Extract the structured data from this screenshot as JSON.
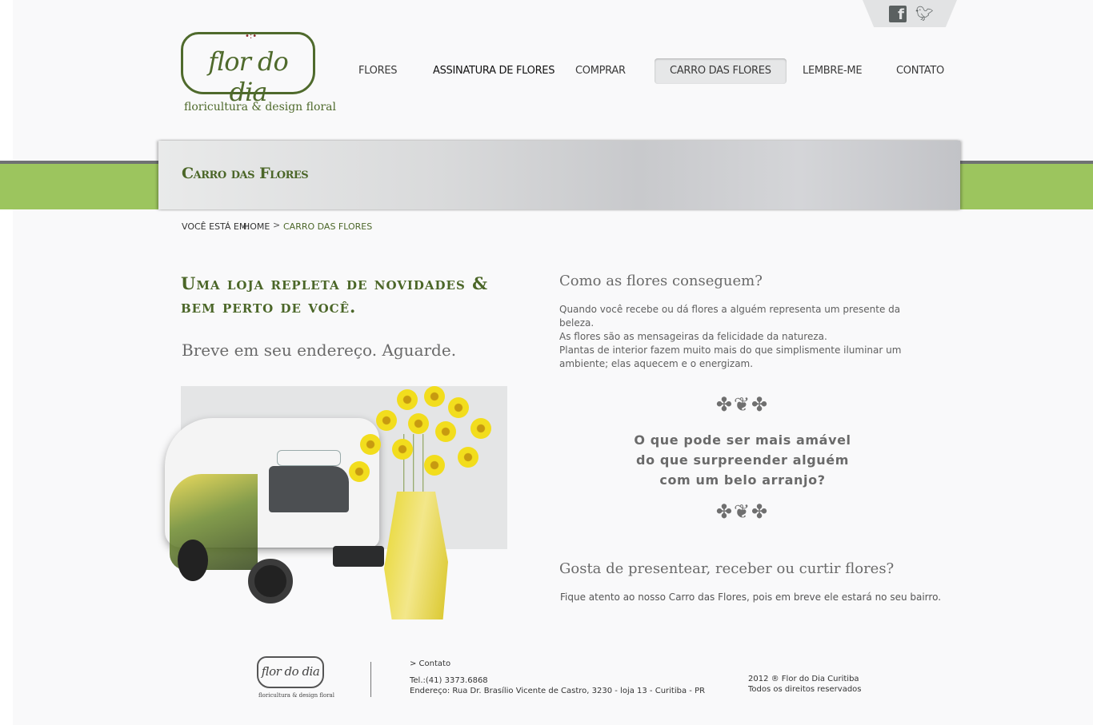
{
  "social": {
    "facebook_icon": "facebook-icon",
    "twitter_icon": "twitter-icon"
  },
  "logo": {
    "name": "flor do dia",
    "tagline": "floricultura & design floral"
  },
  "nav": {
    "items": [
      {
        "label": "FLORES"
      },
      {
        "label": "ASSINATURA DE FLORES"
      },
      {
        "label": "COMPRAR"
      },
      {
        "label": "CARRO DAS FLORES"
      },
      {
        "label": "LEMBRE-ME"
      },
      {
        "label": "CONTATO"
      }
    ],
    "active_index": 3
  },
  "banner": {
    "title": "Carro das Flores"
  },
  "breadcrumb": {
    "label": "VOCÊ ESTÁ EM:",
    "home": "HOME",
    "separator": ">",
    "current": "CARRO DAS FLORES"
  },
  "left": {
    "headline": "Uma loja repleta de novidades & bem perto de você.",
    "subheadline": "Breve em seu endereço. Aguarde."
  },
  "right": {
    "question1": "Como as flores conseguem?",
    "para1_line1": "Quando você recebe ou dá flores a alguém representa um presente da beleza.",
    "para1_line2": "As flores são as mensageiras da felicidade da natureza.",
    "para2_line1": "Plantas de interior fazem muito mais do que simplismente iluminar um",
    "para2_line2": "ambiente; elas aquecem e o energizam.",
    "quote_line1": "O que pode ser mais amável",
    "quote_line2": "do que surpreender alguém",
    "quote_line3": "com um belo arranjo?",
    "question2": "Gosta de presentear, receber ou curtir flores?",
    "para3": "Fique atento ao nosso Carro das Flores, pois em breve ele estará no seu bairro."
  },
  "footer": {
    "logo_name": "flor do dia",
    "logo_tagline": "floricultura & design floral",
    "contact_link": "> Contato",
    "tel": "Tel.:(41) 3373.6868",
    "address": "Endereço: Rua Dr. Brasílio Vicente de Castro, 3230 - loja 13 - Curitiba - PR",
    "copyright1": "2012 ® Flor do Dia Curitiba",
    "copyright2": "Todos os direitos reservados"
  },
  "colors": {
    "brand_green": "#4b6628",
    "band_green": "#9cc55e"
  }
}
